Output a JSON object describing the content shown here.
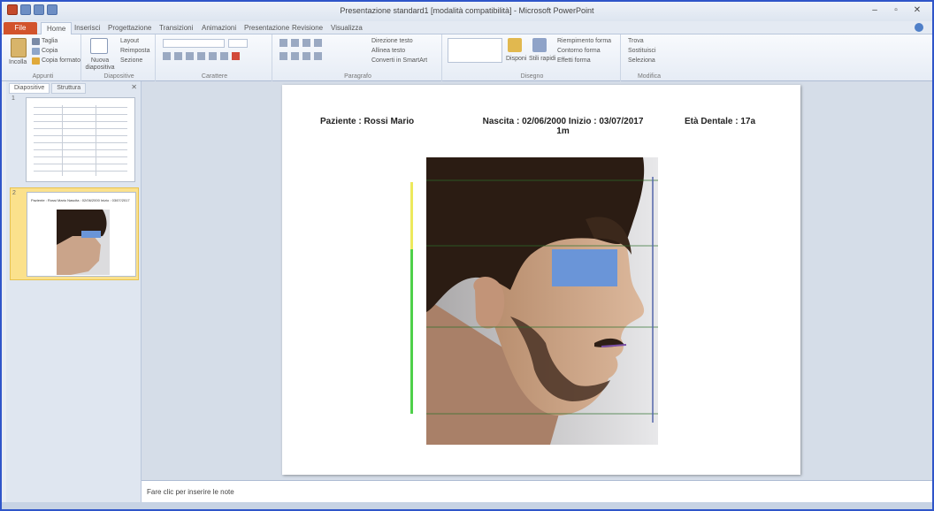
{
  "window": {
    "title": "Presentazione standard1 [modalità compatibilità] - Microsoft PowerPoint",
    "controls": [
      "–",
      "▫",
      "✕"
    ]
  },
  "ribbon_tabs": [
    "File",
    "Home",
    "Inserisci",
    "Progettazione",
    "Transizioni",
    "Animazioni",
    "Presentazione",
    "Revisione",
    "Visualizza"
  ],
  "ribbon": {
    "clipboard": {
      "paste": "Incolla",
      "cut": "Taglia",
      "copy": "Copia",
      "format": "Copia formato",
      "label": "Appunti"
    },
    "slides": {
      "new": "Nuova diapositiva",
      "layout": "Layout",
      "reset": "Reimposta",
      "section": "Sezione",
      "label": "Diapositive"
    },
    "font": {
      "label": "Carattere"
    },
    "paragraph": {
      "direction": "Direzione testo",
      "align": "Allinea testo",
      "smartart": "Converti in SmartArt",
      "label": "Paragrafo"
    },
    "drawing": {
      "arrange": "Disponi",
      "styles": "Stili rapidi",
      "fill": "Riempimento forma",
      "outline": "Contorno forma",
      "effects": "Effetti forma",
      "label": "Disegno"
    },
    "editing": {
      "find": "Trova",
      "replace": "Sostituisci",
      "select": "Seleziona",
      "label": "Modifica"
    }
  },
  "panel": {
    "tabs": [
      "Diapositive",
      "Struttura"
    ],
    "thumb2_text": "Paziente : Rossi Mario      Nascita : 02/06/2000  Inizio : 03/07/2017"
  },
  "slide": {
    "patient": "Paziente : Rossi Mario",
    "birth_start": "Nascita : 02/06/2000  Inizio : 03/07/2017",
    "birth_start_cont": "1m",
    "dental_age": "Età Dentale : 17a"
  },
  "notes_placeholder": "Fare clic per inserire le note"
}
